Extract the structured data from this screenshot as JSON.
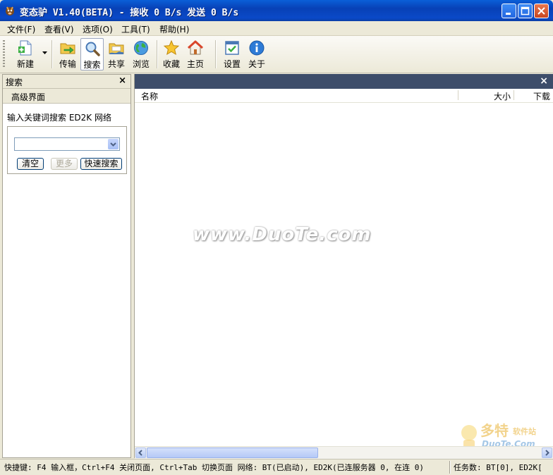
{
  "window": {
    "title": "变态驴 V1.40(BETA) - 接收 0 B/s 发送 0 B/s"
  },
  "menu": [
    "文件(F)",
    "查看(V)",
    "选项(O)",
    "工具(T)",
    "帮助(H)"
  ],
  "toolbar": {
    "new": "新建",
    "transfer": "传输",
    "search": "搜索",
    "share": "共享",
    "browse": "浏览",
    "favorites": "收藏",
    "home": "主页",
    "settings": "设置",
    "about": "关于"
  },
  "search_panel": {
    "title": "搜索",
    "close": "×",
    "advanced": "高级界面",
    "hint": "输入关键词搜索 ED2K 网络",
    "input_value": "",
    "clear": "清空",
    "more": "更多",
    "quick_search": "快速搜索"
  },
  "results": {
    "close": "×",
    "columns": [
      "名称",
      "大小",
      "下载"
    ]
  },
  "watermark": "www.DuoTe.com",
  "statusbar": {
    "left": "快捷键: F4 输入框，Ctrl+F4 关闭页面, Ctrl+Tab 切换页面 网络: BT(已启动), ED2K(已连服务器 0, 在连 0)",
    "right": "任务数: BT[0], ED2K["
  },
  "colors": {
    "titlebar": "#0841B6",
    "results_header": "#3D4D6A",
    "window_bg": "#ECE9D8"
  }
}
